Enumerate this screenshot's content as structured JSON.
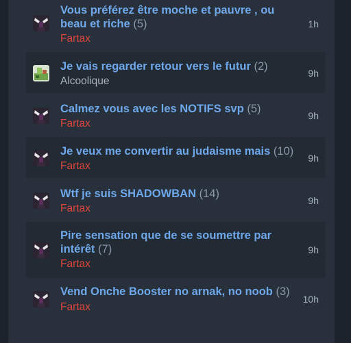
{
  "topics": [
    {
      "title_line1": "Vous préférez être moche et pauvre , ou",
      "title_line2": "beau et riche",
      "count": "(5)",
      "author": "Fartax",
      "time": "1h"
    },
    {
      "title": "Je vais regarder retour vers le futur",
      "count": "(2)",
      "author": "Alcoolique",
      "time": "9h"
    },
    {
      "title": "Calmez vous avec les NOTIFS svp",
      "count": "(5)",
      "author": "Fartax",
      "time": "9h"
    },
    {
      "title": "Je veux me convertir au judaisme mais",
      "count": "(10)",
      "author": "Fartax",
      "time": "9h"
    },
    {
      "title": "Wtf je suis SHADOWBAN",
      "count": "(14)",
      "author": "Fartax",
      "time": "9h"
    },
    {
      "title_line1": "Pire sensation que de se soumettre par",
      "title_line2": "intérêt",
      "count": "(7)",
      "author": "Fartax",
      "time": "9h"
    },
    {
      "title": "Vend Onche Booster no arnak, no noob",
      "count": "(3)",
      "author": "Fartax",
      "time": "10h"
    }
  ]
}
